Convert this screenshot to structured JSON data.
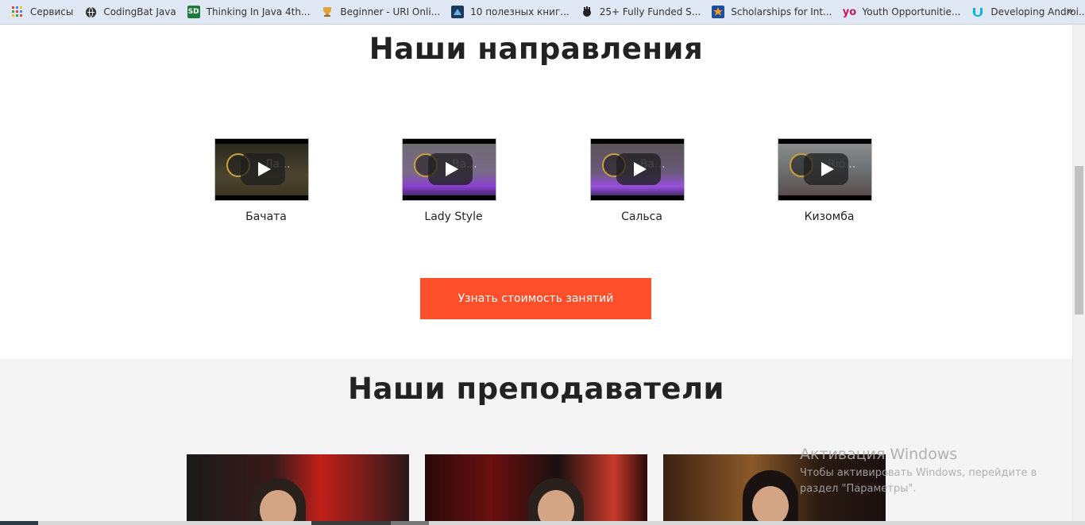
{
  "bookmarks": [
    {
      "label": "Сервисы",
      "icon": "apps-grid-icon"
    },
    {
      "label": "CodingBat Java",
      "icon": "globe-icon"
    },
    {
      "label": "Thinking In Java 4th...",
      "icon": "sd-icon"
    },
    {
      "label": "Beginner - URI Onli...",
      "icon": "trophy-icon"
    },
    {
      "label": "10 полезных книг...",
      "icon": "book-icon"
    },
    {
      "label": "25+ Fully Funded S...",
      "icon": "hand-icon"
    },
    {
      "label": "Scholarships for Int...",
      "icon": "star-icon"
    },
    {
      "label": "Youth Opportunitie...",
      "icon": "yo-icon"
    },
    {
      "label": "Developing Androi...",
      "icon": "udacity-icon"
    }
  ],
  "bookmarks_overflow": "»",
  "sections": {
    "directions": {
      "title": "Наши направления",
      "videos": [
        {
          "label": "Бачата",
          "overlay": "Ла...",
          "scene_color": "#3c3a2c"
        },
        {
          "label": "Lady Style",
          "overlay": "Ва...",
          "scene_color": "#5a3a7a"
        },
        {
          "label": "Сальса",
          "overlay": "Ва...",
          "scene_color": "#4b3a6a"
        },
        {
          "label": "Кизомба",
          "overlay": "Rio...",
          "scene_color": "#6a7072"
        }
      ],
      "cta_label": "Узнать стоимость занятий"
    },
    "teachers": {
      "title": "Наши преподаватели",
      "cards": [
        {
          "name": "teacher-1"
        },
        {
          "name": "teacher-2"
        },
        {
          "name": "teacher-3"
        }
      ]
    }
  },
  "watermark": {
    "title": "Активация Windows",
    "line1": "Чтобы активировать Windows, перейдите в",
    "line2": "раздел \"Параметры\"."
  },
  "colors": {
    "accent": "#ff4f2b",
    "bookmarks_bg": "#dfe8f4",
    "section_gray": "#f4f4f4"
  }
}
